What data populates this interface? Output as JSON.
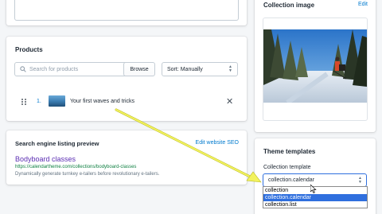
{
  "products": {
    "title": "Products",
    "search_placeholder": "Search for products",
    "browse_label": "Browse",
    "sort_label": "Sort: Manually",
    "items": [
      {
        "index": "1.",
        "name": "Your first waves and tricks"
      }
    ]
  },
  "seo": {
    "title": "Search engine listing preview",
    "edit_link": "Edit website SEO",
    "page_title": "Bodyboard classes",
    "url": "https://calendartheme.com/collections/bodyboard-classes",
    "description": "Dynamically generate turnkey e-tailers before revolutionary e-tailers."
  },
  "collection_image": {
    "title": "Collection image",
    "edit_link": "Edit"
  },
  "theme_templates": {
    "title": "Theme templates",
    "field_label": "Collection template",
    "selected": "collection.calendar",
    "options": [
      "collection",
      "collection.calendar",
      "collection.list"
    ],
    "highlighted_index": 1
  },
  "colors": {
    "accent": "#007ace",
    "link_purple": "#5c2fb3",
    "highlight": "#2f6fde",
    "annotation_arrow": "#f0f05a"
  }
}
